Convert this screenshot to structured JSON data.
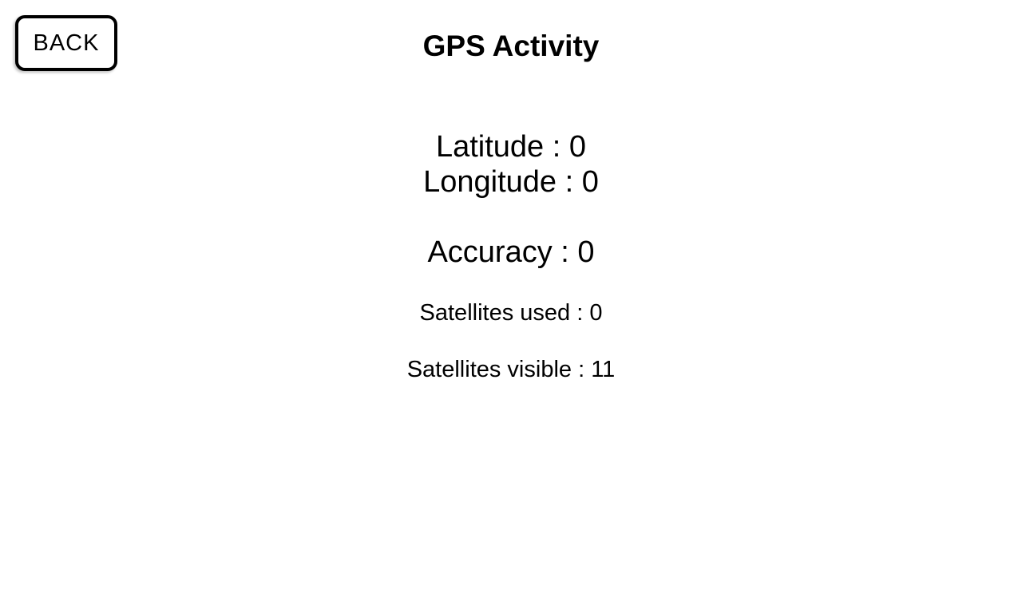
{
  "header": {
    "back_label": "BACK",
    "title": "GPS Activity"
  },
  "readings": {
    "latitude": "Latitude : 0",
    "longitude": "Longitude : 0",
    "accuracy": "Accuracy : 0",
    "satellites_used": "Satellites used : 0",
    "satellites_visible": "Satellites visible : 11"
  },
  "colors": {
    "background": "#ffffff",
    "text": "#000000",
    "button_border": "#000000"
  }
}
